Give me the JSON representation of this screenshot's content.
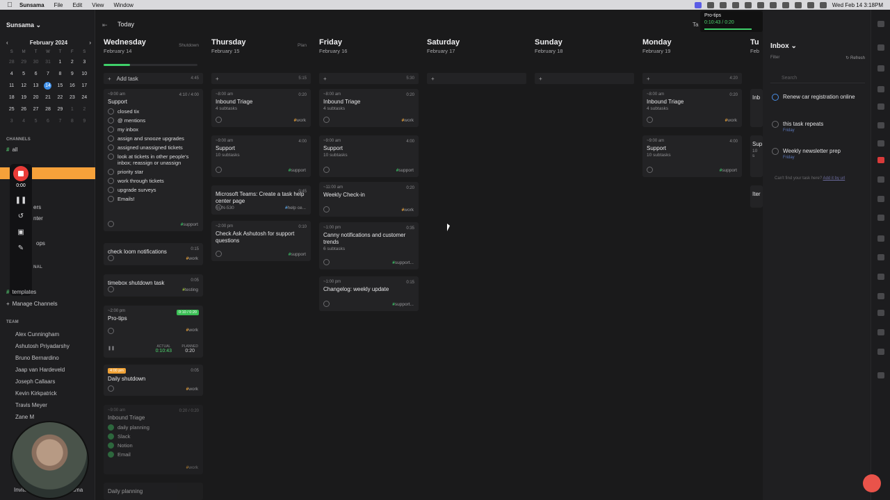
{
  "menubar": {
    "app": "Sunsama",
    "menus": [
      "File",
      "Edit",
      "View",
      "Window"
    ],
    "datetime": "Wed Feb 14  3:18PM"
  },
  "sidebar": {
    "workspace": "Sunsama",
    "calendar": {
      "month": "February 2024",
      "dow": [
        "S",
        "M",
        "T",
        "W",
        "T",
        "F",
        "S"
      ],
      "days": [
        [
          "28",
          "29",
          "30",
          "31",
          "1",
          "2",
          "3"
        ],
        [
          "4",
          "5",
          "6",
          "7",
          "8",
          "9",
          "10"
        ],
        [
          "11",
          "12",
          "13",
          "14",
          "15",
          "16",
          "17"
        ],
        [
          "18",
          "19",
          "20",
          "21",
          "22",
          "23",
          "24"
        ],
        [
          "25",
          "26",
          "27",
          "28",
          "29",
          "1",
          "2"
        ],
        [
          "3",
          "4",
          "5",
          "6",
          "7",
          "8",
          "9"
        ]
      ],
      "today": "14"
    },
    "channels_label": "CHANNELS",
    "channel_all": "all",
    "partial": [
      "ers",
      "nter",
      "ops",
      "NAL"
    ],
    "templates": "templates",
    "manage_channels": "Manage Channels",
    "team_label": "TEAM",
    "team": [
      "Alex Cunningham",
      "Ashutosh Priyadarshy",
      "Bruno Bernardino",
      "Jaap van Hardeveld",
      "Joseph Callaars",
      "Kevin Kirkpatrick",
      "Travis Meyer",
      "Zane M"
    ],
    "invite": "Invite someone to Sunsama",
    "recorder_time": "0:00"
  },
  "header": {
    "today": "Today"
  },
  "columns": [
    {
      "day": "Wednesday",
      "date": "February 14",
      "action": "Shutdown",
      "add_label": "Add task",
      "total": "4:45"
    },
    {
      "day": "Thursday",
      "date": "February 15",
      "action": "Plan",
      "add_label": "",
      "total": "5:15"
    },
    {
      "day": "Friday",
      "date": "February 16",
      "action": "",
      "add_label": "",
      "total": "5:30"
    },
    {
      "day": "Saturday",
      "date": "February 17",
      "action": "",
      "add_label": "",
      "total": ""
    },
    {
      "day": "Sunday",
      "date": "February 18",
      "action": "",
      "add_label": "",
      "total": ""
    },
    {
      "day": "Monday",
      "date": "February 19",
      "action": "",
      "add_label": "",
      "total": "4:20"
    },
    {
      "day": "Tu",
      "date": "Feb",
      "action": "",
      "add_label": "",
      "total": ""
    }
  ],
  "wed": {
    "support": {
      "time": "~9:00 am",
      "dur": "4:10 / 4:00",
      "title": "Support",
      "subtasks": [
        "closed tix",
        "@ mentions",
        "my inbox",
        "assign and snooze upgrades",
        "assigned unassigned tickets",
        "look at tickets in other people's inbox; reassign or unassign",
        "priority star",
        "work through tickets",
        "upgrade surveys",
        "Emails!"
      ],
      "tag": "support"
    },
    "loom": {
      "title": "check loom notifications",
      "dur": "0:15",
      "tag": "work"
    },
    "timebox": {
      "title": "timebox shutdown task",
      "dur": "0:05",
      "tag": "testing"
    },
    "protips": {
      "time": "~2:00 pm",
      "badge": "0:10 / 0:20",
      "title": "Pro-tips",
      "tag": "work",
      "actual_label": "ACTUAL",
      "planned_label": "PLANNED",
      "actual": "0:10:43",
      "planned": "0:20"
    },
    "shutdown": {
      "badge": "4:00 pm",
      "title": "Daily shutdown",
      "dur": "0:05",
      "tag": "work"
    },
    "triage": {
      "time": "~9:00 am",
      "dur": "0:20 / 0:20",
      "title": "Inbound Triage",
      "subtasks": [
        "daily planning",
        "Slack",
        "Notion",
        "Email"
      ],
      "tag": "work"
    },
    "planning": {
      "title": "Daily planning"
    }
  },
  "thu": [
    {
      "time": "~8:00 am",
      "dur": "0:20",
      "title": "Inbound Triage",
      "sub": "4 subtasks",
      "tag": "work"
    },
    {
      "time": "~9:00 am",
      "dur": "4:00",
      "title": "Support",
      "sub": "10 subtasks",
      "tag": "support"
    },
    {
      "time": "",
      "dur": "0:45",
      "title": "Microsoft Teams: Create a task help center page",
      "sub": "SUN-530",
      "tag": "help ce..."
    },
    {
      "time": "~2:00 pm",
      "dur": "0:10",
      "title": "Check Ask Ashutosh for support questions",
      "sub": "",
      "tag": "support"
    }
  ],
  "fri": [
    {
      "time": "~8:00 am",
      "dur": "0:20",
      "title": "Inbound Triage",
      "sub": "4 subtasks",
      "tag": "work"
    },
    {
      "time": "~9:00 am",
      "dur": "4:00",
      "title": "Support",
      "sub": "10 subtasks",
      "tag": "support"
    },
    {
      "time": "~11:00 am",
      "dur": "0:20",
      "title": "Weekly Check-in",
      "sub": "",
      "tag": "work"
    },
    {
      "time": "~1:00 pm",
      "dur": "0:35",
      "title": "Canny notifications and customer trends",
      "sub": "6 subtasks",
      "tag": "support..."
    },
    {
      "time": "~1:00 pm",
      "dur": "0:15",
      "title": "Changelog: weekly update",
      "sub": "",
      "tag": "support..."
    }
  ],
  "mon": [
    {
      "time": "~8:00 am",
      "dur": "0:20",
      "title": "Inbound Triage",
      "sub": "4 subtasks",
      "tag": "work"
    },
    {
      "time": "~9:00 am",
      "dur": "4:00",
      "title": "Support",
      "sub": "10 subtasks",
      "tag": "support"
    }
  ],
  "tue_partial": [
    "Inb",
    "Sup",
    "10 s",
    "Iter"
  ],
  "inbox": {
    "title": "Inbox",
    "filter": "Filter",
    "refresh": "Refresh",
    "search_placeholder": "Search",
    "items": [
      {
        "title": "Renew car registration online",
        "sub": ""
      },
      {
        "title": "this task repeats",
        "sub": "Friday"
      },
      {
        "title": "Weekly newsletter prep",
        "sub": "Friday"
      }
    ],
    "help": "Can't find your task here?",
    "help_link": "Add it by url"
  },
  "tooltip": {
    "title": "Pro-tips",
    "time": "0:10:43 / 0:20"
  },
  "tab_partial": "Ta",
  "list_partial": "st",
  "colors": {
    "accent": "#3fd06a",
    "orange": "#f6a13a",
    "today": "#3d8ee8",
    "record": "#ea3c38"
  }
}
